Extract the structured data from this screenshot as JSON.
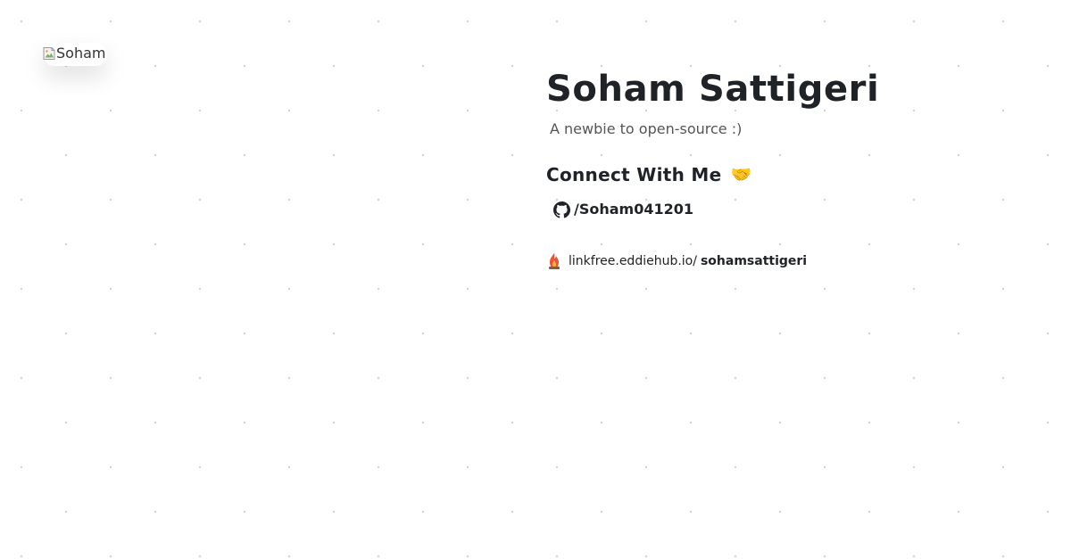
{
  "profile": {
    "avatar_alt": "Soham",
    "name": "Soham Sattigeri",
    "bio": "A newbie to open-source :)"
  },
  "connect": {
    "heading": "Connect With Me",
    "heading_emoji": "🤝",
    "github_label": "/Soham041201"
  },
  "linkfree": {
    "domain": "linkfree.eddiehub.io/",
    "username": "sohamsattigeri"
  },
  "icons": {
    "avatar": "broken-image-icon",
    "github": "github-icon",
    "linkfree": "linkfree-logo-icon"
  }
}
